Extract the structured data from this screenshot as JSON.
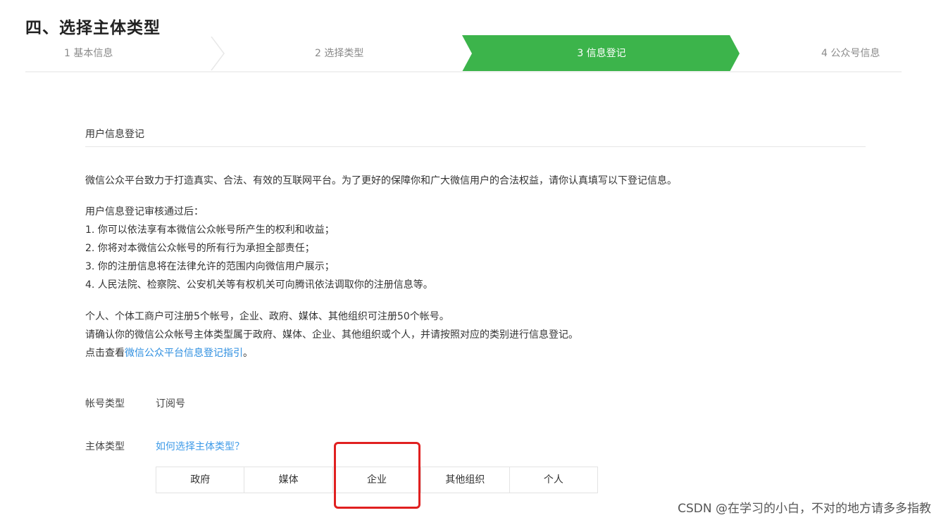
{
  "heading": "四、选择主体类型",
  "steps": [
    {
      "label": "1 基本信息"
    },
    {
      "label": "2 选择类型"
    },
    {
      "label": "3 信息登记"
    },
    {
      "label": "4 公众号信息"
    }
  ],
  "active_step_color": "#3cb44b",
  "section_title": "用户信息登记",
  "intro": "微信公众平台致力于打造真实、合法、有效的互联网平台。为了更好的保障你和广大微信用户的合法权益，请你认真填写以下登记信息。",
  "rules": [
    "用户信息登记审核通过后：",
    "1. 你可以依法享有本微信公众帐号所产生的权利和收益；",
    "2. 你将对本微信公众帐号的所有行为承担全部责任；",
    "3. 你的注册信息将在法律允许的范围内向微信用户展示；",
    "4. 人民法院、检察院、公安机关等有权机关可向腾讯依法调取你的注册信息等。"
  ],
  "notes": {
    "line1": "个人、个体工商户可注册5个帐号，企业、政府、媒体、其他组织可注册50个帐号。",
    "line2": "请确认你的微信公众帐号主体类型属于政府、媒体、企业、其他组织或个人，并请按照对应的类别进行信息登记。",
    "line3_prefix": "点击查看",
    "line3_link": "微信公众平台信息登记指引",
    "line3_suffix": "。"
  },
  "account_type": {
    "label": "帐号类型",
    "value": "订阅号"
  },
  "subject_type": {
    "label": "主体类型",
    "help_link": "如何选择主体类型？",
    "options": [
      "政府",
      "媒体",
      "企业",
      "其他组织",
      "个人"
    ]
  },
  "highlight_color": "#e02020",
  "watermark": "CSDN @在学习的小白，不对的地方请多多指教"
}
